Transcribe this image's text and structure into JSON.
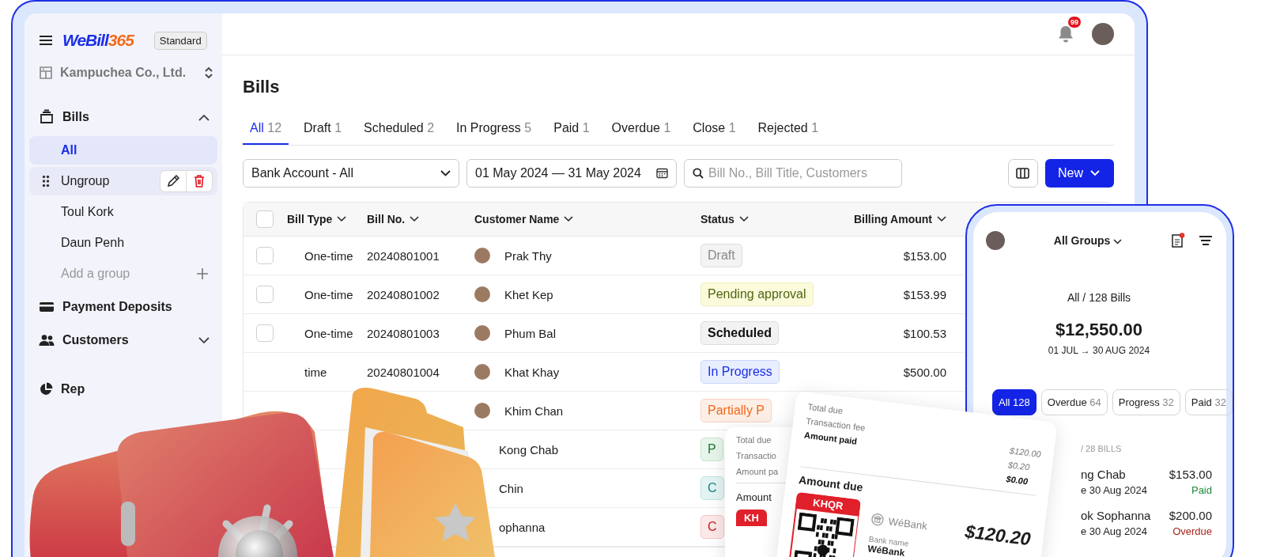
{
  "sidebar": {
    "logo": {
      "name": "WeBill",
      "number": "365"
    },
    "plan": "Standard",
    "company": "Kampuchea Co., Ltd.",
    "nav": [
      {
        "label": "Bills",
        "kind": "bills",
        "expanded": true,
        "children": [
          {
            "label": "All",
            "selected": true,
            "hovered": false
          },
          {
            "label": "Ungroup",
            "selected": false,
            "hovered": true
          },
          {
            "label": "Toul Kork",
            "selected": false,
            "hovered": false
          },
          {
            "label": "Daun Penh",
            "selected": false,
            "hovered": false
          }
        ],
        "add_label": "Add a group"
      },
      {
        "label": "Payment Deposits",
        "kind": "card"
      },
      {
        "label": "Customers",
        "kind": "people",
        "expanded": false
      },
      {
        "label": "Rep",
        "kind": "pie"
      }
    ]
  },
  "topbar": {
    "notifications": "99"
  },
  "title": "Bills",
  "tabs": [
    {
      "label": "All",
      "count": "12",
      "selected": true
    },
    {
      "label": "Draft",
      "count": "1",
      "selected": false
    },
    {
      "label": "Scheduled",
      "count": "2",
      "selected": false
    },
    {
      "label": "In Progress",
      "count": "5",
      "selected": false
    },
    {
      "label": "Paid",
      "count": "1",
      "selected": false
    },
    {
      "label": "Overdue",
      "count": "1",
      "selected": false
    },
    {
      "label": "Close",
      "count": "1",
      "selected": false
    },
    {
      "label": "Rejected",
      "count": "1",
      "selected": false
    }
  ],
  "filters": {
    "bank_account": "Bank Account - All",
    "date_range": "01 May 2024 — 31 May 2024",
    "search_placeholder": "Bill No., Bill Title, Customers",
    "new_button": "New"
  },
  "table": {
    "all_checked": false,
    "columns": [
      "Bill Type",
      "Bill No.",
      "Customer Name",
      "Status",
      "Billing Amount"
    ],
    "rows": [
      {
        "checked": false,
        "type": "One-time",
        "number": "20240801001",
        "customer": "Prak Thy",
        "avatar": true,
        "status": "Draft",
        "kind": "draft",
        "amount": "$153.00"
      },
      {
        "checked": false,
        "type": "One-time",
        "number": "20240801002",
        "customer": "Khet Kep",
        "avatar": true,
        "status": "Pending approval",
        "kind": "pending",
        "amount": "$153.99"
      },
      {
        "checked": false,
        "type": "One-time",
        "number": "20240801003",
        "customer": "Phum Bal",
        "avatar": true,
        "status": "Scheduled",
        "kind": "scheduled",
        "amount": "$100.53"
      },
      {
        "type": "time",
        "number": "20240801004",
        "customer": "Khat Khay",
        "avatar": true,
        "status": "In Progress",
        "kind": "progress",
        "amount": "$500.00"
      },
      {
        "customer": "Khim Chan",
        "avatar": true,
        "status": "Partially P",
        "kind": "partial"
      },
      {
        "customer": "Kong Chab",
        "avatar": false,
        "status": "P",
        "kind": "paid"
      },
      {
        "customer": "Chin",
        "avatar": false,
        "status": "C",
        "kind": "closed"
      },
      {
        "customer": "ophanna",
        "avatar": false,
        "status": "C",
        "kind": "rejected"
      }
    ]
  },
  "back_receipt": {
    "labels": [
      "Total due",
      "Transactio",
      "Amount pa"
    ],
    "due_label": "Amount",
    "qr_label": "KH"
  },
  "front_receipt": {
    "labels": [
      "Total due",
      "Transaction fee",
      "Amount paid"
    ],
    "values": [
      "$120.00",
      "$0.20",
      "$0.00"
    ],
    "due_label": "Amount due",
    "qr_label": "KHQR",
    "bank": "WéBank",
    "bank_name_label": "Bank name",
    "bank_name": "WéBank",
    "amount": "$120.20"
  },
  "phone": {
    "group": "All Groups",
    "summary": "All / 128 Bills",
    "total": "$12,550.00",
    "period": "01 JUL → 30 AUG 2024",
    "chips": [
      {
        "label": "All",
        "count": "128",
        "selected": true
      },
      {
        "label": "Overdue",
        "count": "64",
        "selected": false
      },
      {
        "label": "Progress",
        "count": "32",
        "selected": false
      },
      {
        "label": "Paid",
        "count": "32",
        "selected": false
      }
    ],
    "section": "/ 28 BILLS",
    "bills": [
      {
        "name": "ng Chab",
        "amount": "$153.00",
        "due": "e 30 Aug 2024",
        "status": "Paid",
        "kind": "paid"
      },
      {
        "name": "ok Sophanna",
        "amount": "$200.00",
        "due": "e 30 Aug 2024",
        "status": "Overdue",
        "kind": "overdue"
      }
    ]
  }
}
